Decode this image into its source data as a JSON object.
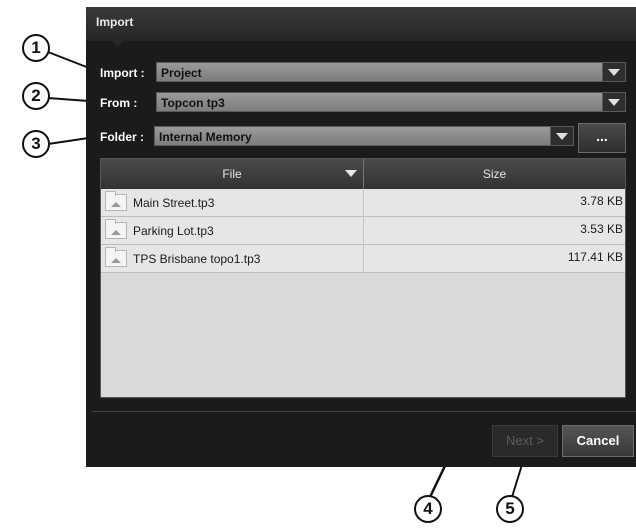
{
  "dialog": {
    "title": "Import"
  },
  "fields": {
    "import": {
      "label": "Import :",
      "value": "Project"
    },
    "from": {
      "label": "From :",
      "value": "Topcon tp3"
    },
    "folder": {
      "label": "Folder :",
      "value": "Internal Memory",
      "browse_label": "..."
    }
  },
  "table": {
    "columns": [
      "File",
      "Size"
    ],
    "rows": [
      {
        "file": "Main Street.tp3",
        "size": "3.78 KB"
      },
      {
        "file": "Parking Lot.tp3",
        "size": "3.53 KB"
      },
      {
        "file": "TPS Brisbane topo1.tp3",
        "size": "117.41 KB"
      }
    ]
  },
  "buttons": {
    "next": "Next >",
    "cancel": "Cancel"
  },
  "callouts": [
    "1",
    "2",
    "3",
    "4",
    "5"
  ]
}
